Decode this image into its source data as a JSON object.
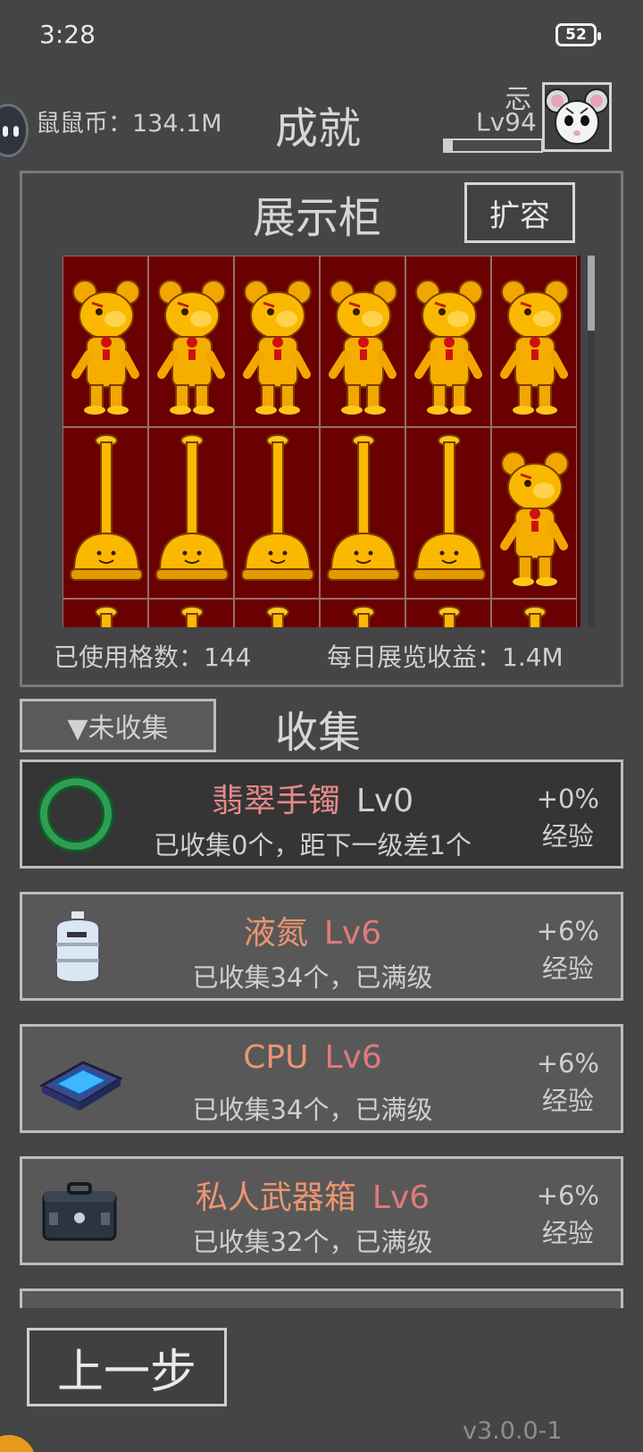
{
  "status_bar": {
    "time": "3:28",
    "battery": "52"
  },
  "header": {
    "coins_label": "鼠鼠币：134.1M",
    "title": "成就",
    "player_name": "忈",
    "player_level": "Lv94",
    "xp_progress": 0.08
  },
  "cabinet": {
    "title": "展示柜",
    "expand_button": "扩容",
    "rows": [
      [
        "bear",
        "bear",
        "bear",
        "bear",
        "bear",
        "bear"
      ],
      [
        "plunger",
        "plunger",
        "plunger",
        "plunger",
        "plunger",
        "bear"
      ],
      [
        "plunger",
        "plunger",
        "plunger",
        "plunger",
        "plunger",
        "plunger"
      ]
    ],
    "used_cells_label": "已使用格数：144",
    "daily_income_label": "每日展览收益：1.4M"
  },
  "collection": {
    "filter_button": "▼未收集",
    "title": "收集",
    "items": [
      {
        "name": "翡翠手镯",
        "level": "Lv0",
        "desc": "已收集0个，距下一级差1个",
        "bonus": "+0%",
        "bonus_unit": "经验",
        "icon": "jade-bracelet-icon",
        "name_color": "#e88a8a",
        "level_color": "#d0d0d0",
        "dark": true
      },
      {
        "name": "液氮",
        "level": "Lv6",
        "desc": "已收集34个，已满级",
        "bonus": "+6%",
        "bonus_unit": "经验",
        "icon": "liquid-nitrogen-tank-icon",
        "name_color": "#ec9570",
        "level_color": "#e07a7a",
        "dark": false
      },
      {
        "name": "CPU",
        "level": "Lv6",
        "desc": "已收集34个，已满级",
        "bonus": "+6%",
        "bonus_unit": "经验",
        "icon": "cpu-chip-icon",
        "name_color": "#ec9570",
        "level_color": "#e07a7a",
        "dark": false
      },
      {
        "name": "私人武器箱",
        "level": "Lv6",
        "desc": "已收集32个，已满级",
        "bonus": "+6%",
        "bonus_unit": "经验",
        "icon": "weapon-case-icon",
        "name_color": "#ec9570",
        "level_color": "#e07a7a",
        "dark": false
      }
    ]
  },
  "footer": {
    "back_button": "上一步",
    "version": "v3.0.0-1"
  }
}
